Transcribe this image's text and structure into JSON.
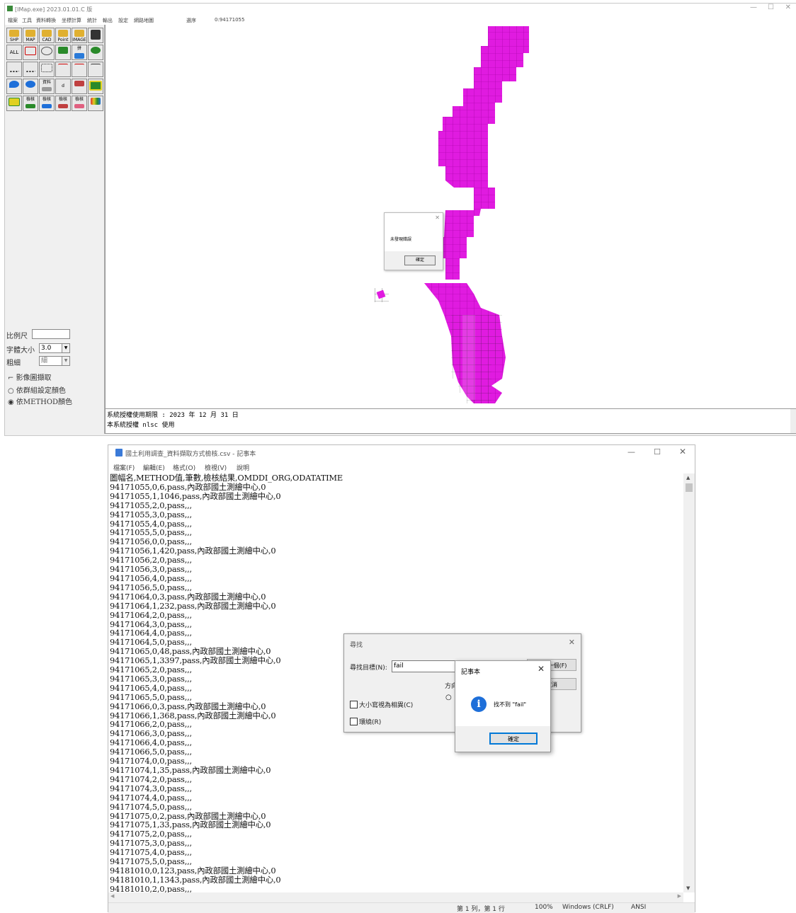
{
  "map_app": {
    "title": "[IMap.exe] 2023.01.01.C 版",
    "coord_label": "選序",
    "coord_value": "0:94171055",
    "menu": [
      "檔案",
      "工具",
      "資料轉換",
      "坐標計算",
      "統計",
      "輸出",
      "設定",
      "網路地圖"
    ],
    "tools": {
      "row1": [
        "SHP",
        "MAP",
        "CAD",
        "Point",
        "IMAGE",
        "save"
      ],
      "row2": [
        "ALL",
        "",
        "",
        "",
        "拼",
        ""
      ],
      "row3": [
        "",
        "",
        "",
        "",
        "",
        ""
      ],
      "row4": [
        "",
        "",
        "資料",
        "d",
        "",
        ""
      ],
      "row5": [
        "",
        "檢核",
        "檢核",
        "檢核",
        "檢核",
        ""
      ]
    },
    "scale_label": "比例尺",
    "scale_value": "",
    "fontsize_label": "字體大小",
    "fontsize_value": "3.0",
    "weight_label": "粗細",
    "weight_value": "細",
    "options": [
      {
        "label": "影像圖擷取",
        "type": "checkbox",
        "checked": false
      },
      {
        "label": "依群組設定顏色",
        "type": "radio",
        "checked": false
      },
      {
        "label": "依METHOD顏色",
        "type": "radio",
        "checked": true
      }
    ],
    "log_lines": [
      "系統授權使用期限 : 2023 年 12 月 31 日",
      "本系統授權 nlsc 使用"
    ],
    "map_color": "#e01be0",
    "dialog": {
      "message": "未發現錯誤",
      "ok_label": "確定"
    }
  },
  "notepad": {
    "title": "國土利用調查_資料擷取方式檢核.csv - 記事本",
    "menu": [
      "檔案(F)",
      "編輯(E)",
      "格式(O)",
      "檢視(V)",
      "說明"
    ],
    "lines": [
      "圖幅名,METHOD值,筆數,檢核結果,OMDDI_ORG,ODATATIME",
      "94171055,0,6,pass,內政部國土測繪中心,0",
      "94171055,1,1046,pass,內政部國土測繪中心,0",
      "94171055,2,0,pass,,,",
      "94171055,3,0,pass,,,",
      "94171055,4,0,pass,,,",
      "94171055,5,0,pass,,,",
      "94171056,0,0,pass,,,",
      "94171056,1,420,pass,內政部國土測繪中心,0",
      "94171056,2,0,pass,,,",
      "94171056,3,0,pass,,,",
      "94171056,4,0,pass,,,",
      "94171056,5,0,pass,,,",
      "94171064,0,3,pass,內政部國土測繪中心,0",
      "94171064,1,232,pass,內政部國土測繪中心,0",
      "94171064,2,0,pass,,,",
      "94171064,3,0,pass,,,",
      "94171064,4,0,pass,,,",
      "94171064,5,0,pass,,,",
      "94171065,0,48,pass,內政部國土測繪中心,0",
      "94171065,1,3397,pass,內政部國土測繪中心,0",
      "94171065,2,0,pass,,,",
      "94171065,3,0,pass,,,",
      "94171065,4,0,pass,,,",
      "94171065,5,0,pass,,,",
      "94171066,0,3,pass,內政部國土測繪中心,0",
      "94171066,1,368,pass,內政部國土測繪中心,0",
      "94171066,2,0,pass,,,",
      "94171066,3,0,pass,,,",
      "94171066,4,0,pass,,,",
      "94171066,5,0,pass,,,",
      "94171074,0,0,pass,,,",
      "94171074,1,35,pass,內政部國土測繪中心,0",
      "94171074,2,0,pass,,,",
      "94171074,3,0,pass,,,",
      "94171074,4,0,pass,,,",
      "94171074,5,0,pass,,,",
      "94171075,0,2,pass,內政部國土測繪中心,0",
      "94171075,1,33,pass,內政部國土測繪中心,0",
      "94171075,2,0,pass,,,",
      "94171075,3,0,pass,,,",
      "94171075,4,0,pass,,,",
      "94171075,5,0,pass,,,",
      "94181010,0,123,pass,內政部國土測繪中心,0",
      "94181010,1,1343,pass,內政部國土測繪中心,0",
      "94181010,2,0,pass,,,"
    ],
    "status": {
      "position": "第 1 列，第 1 行",
      "zoom": "100%",
      "eol": "Windows (CRLF)",
      "encoding": "ANSI"
    },
    "find": {
      "title": "尋找",
      "target_label": "尋找目標(N):",
      "target_value": "fail",
      "find_next": "找下一個(F)",
      "cancel": "取消",
      "direction_label": "方向",
      "match_case": "大小寫視為相異(C)",
      "wrap": "環繞(R)"
    },
    "alert": {
      "title": "記事本",
      "message": "找不到 \"fail\"",
      "ok_label": "確定",
      "icon": "info-icon"
    }
  }
}
